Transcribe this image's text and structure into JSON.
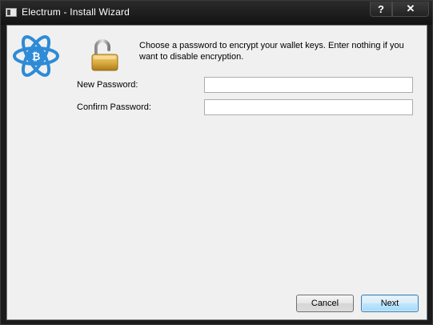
{
  "window": {
    "title": "Electrum  -  Install Wizard",
    "help_label": "?",
    "close_label": "✕"
  },
  "wizard": {
    "message": "Choose a password to encrypt your wallet keys.  Enter nothing if you want to disable encryption.",
    "new_password_label": "New Password:",
    "new_password_value": "",
    "confirm_password_label": "Confirm Password:",
    "confirm_password_value": ""
  },
  "buttons": {
    "cancel_label": "Cancel",
    "next_label": "Next"
  },
  "colors": {
    "logo_blue": "#2e8bd6",
    "lock_gold": "#d9a93c",
    "client_bg": "#f0f0f0"
  }
}
